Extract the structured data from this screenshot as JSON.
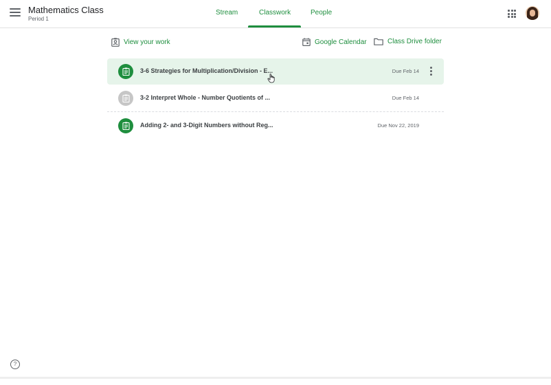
{
  "header": {
    "class_title": "Mathematics Class",
    "class_subtitle": "Period 1",
    "tabs": [
      {
        "label": "Stream"
      },
      {
        "label": "Classwork",
        "active": true
      },
      {
        "label": "People"
      }
    ],
    "icons": {
      "menu": "hamburger-icon",
      "apps": "apps-grid-icon",
      "avatar": "user-avatar"
    }
  },
  "toolbar": {
    "view_work_label": "View your work",
    "calendar_label": "Google Calendar",
    "drive_label": "Class Drive folder"
  },
  "assignments": [
    {
      "title": "3-6 Strategies for Multiplication/Division - E...",
      "due": "Due Feb 14",
      "icon_color": "#1e8e3e",
      "highlighted": true
    },
    {
      "title": "3-2 Interpret Whole - Number Quotients of ...",
      "due": "Due Feb 14",
      "icon_color": "#c6c6c6"
    },
    {
      "title": "Adding 2- and 3-Digit Numbers without Reg...",
      "due": "Due Nov 22, 2019",
      "icon_color": "#1e8e3e"
    }
  ],
  "help_label": "?",
  "colors": {
    "accent": "#1e8e3e",
    "highlight": "#e6f4ea"
  }
}
